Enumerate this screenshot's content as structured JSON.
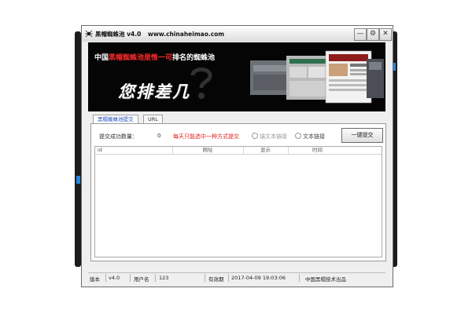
{
  "window": {
    "title": "黑帽蜘蛛池 v4.0",
    "url": "www.chinaheimao.com",
    "buttons": {
      "minimize": "—",
      "settings": "⚙",
      "close": "✕"
    }
  },
  "banner": {
    "headline_prefix": "中国",
    "headline_highlight": "黑帽蜘蛛池是惟一可",
    "headline_suffix": "排名的蜘蛛池",
    "slogan": "您排差几"
  },
  "tabs": [
    {
      "label": "黑帽蜘蛛池提交",
      "active": true
    },
    {
      "label": "URL",
      "active": false
    }
  ],
  "submit_panel": {
    "success_count_label": "提交成功数量：",
    "success_count_value": "0",
    "notice": "每天只能选中一种方式提交",
    "radio_options": [
      {
        "label": "锚文本链接",
        "selected": false,
        "enabled": false
      },
      {
        "label": "文本链接",
        "selected": false,
        "enabled": true
      }
    ],
    "submit_button": "一键提交"
  },
  "table": {
    "columns": [
      "id",
      "网址",
      "显示",
      "时间"
    ],
    "rows": []
  },
  "statusbar": {
    "version_label": "版本",
    "version_value": "v4.0",
    "user_label": "用户名",
    "user_value": "123",
    "expiry_label": "有效期",
    "expiry_value": "2017-04-09 19:03:06",
    "credit": "中国黑帽技术出品"
  },
  "colors": {
    "notice": "#e0201c",
    "tab_active": "#1e4dbd",
    "banner_bg": "#050505",
    "highlight_red": "#ff2a2a"
  }
}
